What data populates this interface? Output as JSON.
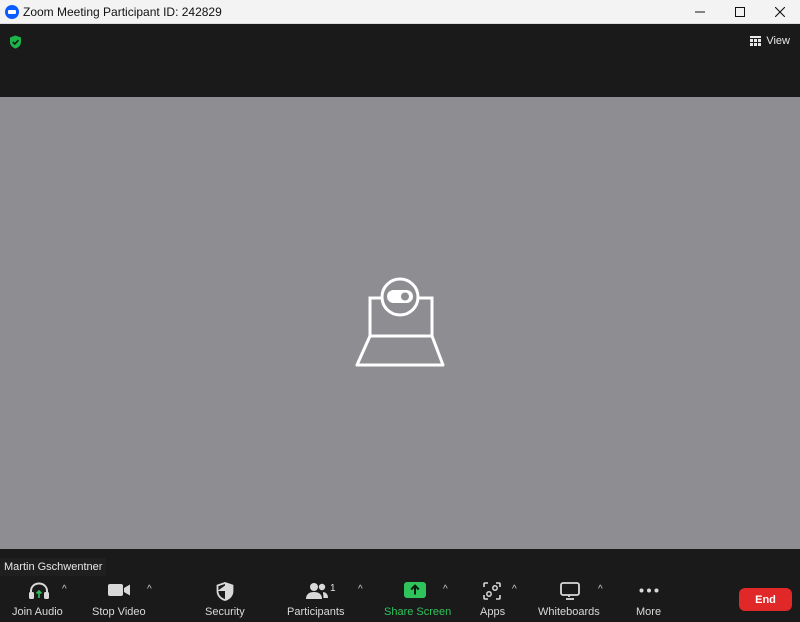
{
  "window": {
    "title": "Zoom Meeting Participant ID: 242829",
    "controls": [
      "minimize-icon",
      "maximize-icon",
      "close-icon"
    ]
  },
  "topbar": {
    "security_status_icon": "shield-check-icon",
    "view_label": "View"
  },
  "video": {
    "state_icon": "camera-off-laptop-icon",
    "background_color": "#8e8d92"
  },
  "participant": {
    "name": "Martin Gschwentner"
  },
  "toolbar": {
    "join_audio": "Join Audio",
    "stop_video": "Stop Video",
    "security": "Security",
    "participants": "Participants",
    "participants_count": "1",
    "share_screen": "Share Screen",
    "apps": "Apps",
    "whiteboards": "Whiteboards",
    "more": "More",
    "end": "End"
  },
  "colors": {
    "accent_share": "#2fc35c",
    "end_button": "#e02828",
    "zoom_blue": "#0b5cff"
  }
}
